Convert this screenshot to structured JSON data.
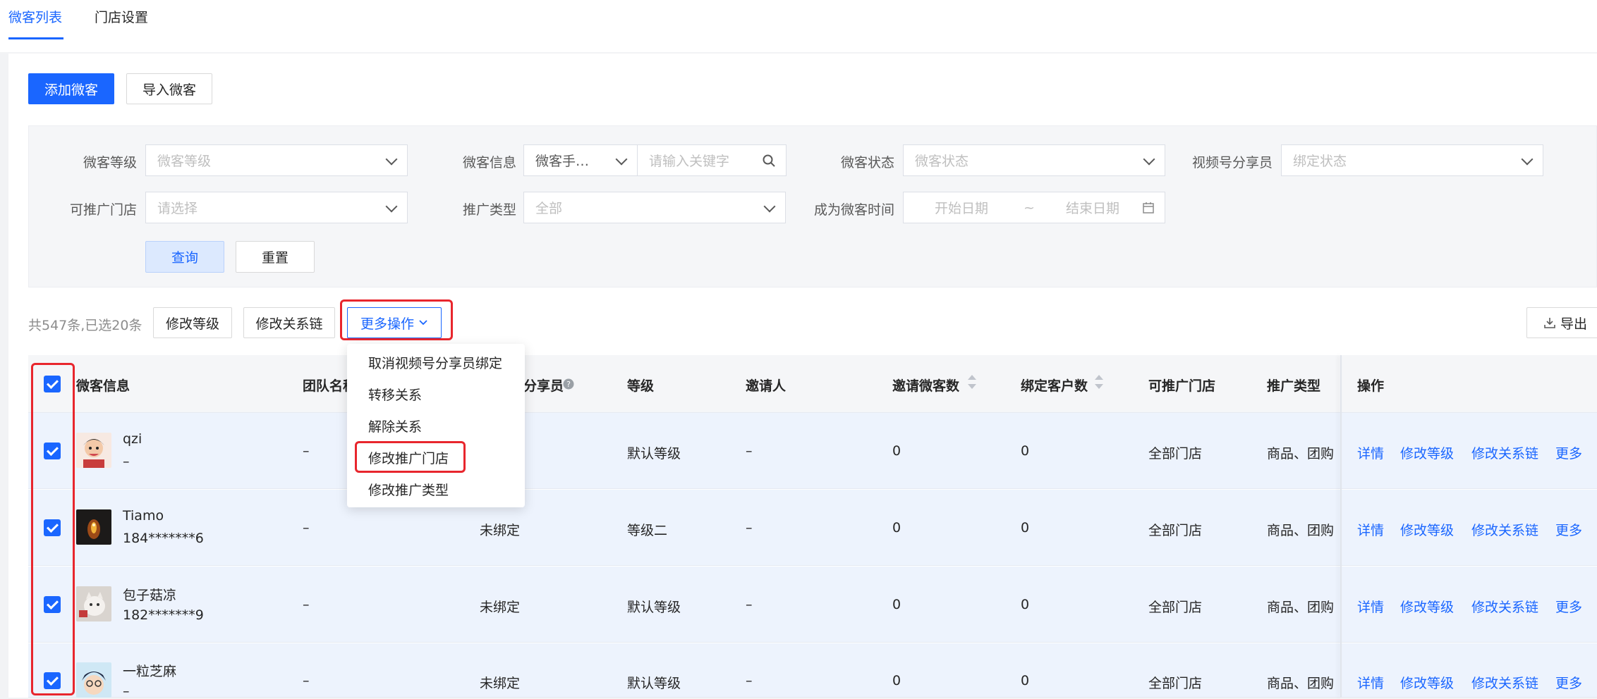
{
  "tabs": [
    {
      "label": "微客列表",
      "active": true
    },
    {
      "label": "门店设置",
      "active": false
    }
  ],
  "toolbar": {
    "add_label": "添加微客",
    "import_label": "导入微客"
  },
  "filters": {
    "level_label": "微客等级",
    "level_placeholder": "微客等级",
    "info_label": "微客信息",
    "info_type_value": "微客手…",
    "info_keyword_placeholder": "请输入关键字",
    "status_label": "微客状态",
    "status_placeholder": "微客状态",
    "sharer_label": "视频号分享员",
    "sharer_placeholder": "绑定状态",
    "store_label": "可推广门店",
    "store_placeholder": "请选择",
    "promo_type_label": "推广类型",
    "promo_type_value": "全部",
    "date_label": "成为微客时间",
    "start_placeholder": "开始日期",
    "date_sep": "~",
    "end_placeholder": "结束日期",
    "query_label": "查询",
    "reset_label": "重置"
  },
  "actions": {
    "count_text": "共547条,已选20条",
    "modify_level": "修改等级",
    "modify_chain": "修改关系链",
    "more_ops": "更多操作",
    "export": "导出"
  },
  "dropdown_menu": {
    "items": [
      "取消视频号分享员绑定",
      "转移关系",
      "解除关系",
      "修改推广门店",
      "修改推广类型"
    ],
    "highlighted": "修改推广门店"
  },
  "table": {
    "headers": {
      "info": "微客信息",
      "team_visible": "团队名称",
      "sharer_visible": "分享员",
      "level": "等级",
      "inviter": "邀请人",
      "invite_count": "邀请微客数",
      "bind_count": "绑定客户数",
      "stores": "可推广门店",
      "promo_type": "推广类型",
      "ops": "操作"
    },
    "rows": [
      {
        "name": "qzi",
        "phone": "–",
        "team": "–",
        "sharer": "",
        "level": "默认等级",
        "inviter": "–",
        "invite": "0",
        "bind": "0",
        "stores": "全部门店",
        "promo": "商品、团购"
      },
      {
        "name": "Tiamo",
        "phone": "184*******6",
        "team": "–",
        "sharer": "未绑定",
        "level": "等级二",
        "inviter": "–",
        "invite": "0",
        "bind": "0",
        "stores": "全部门店",
        "promo": "商品、团购"
      },
      {
        "name": "包子菇凉",
        "phone": "182*******9",
        "team": "–",
        "sharer": "未绑定",
        "level": "默认等级",
        "inviter": "–",
        "invite": "0",
        "bind": "0",
        "stores": "全部门店",
        "promo": "商品、团购"
      },
      {
        "name": "一粒芝麻",
        "phone": "–",
        "team": "–",
        "sharer": "未绑定",
        "level": "默认等级",
        "inviter": "–",
        "invite": "0",
        "bind": "0",
        "stores": "全部门店",
        "promo": "商品、团购"
      }
    ],
    "row_ops": {
      "detail": "详情",
      "modify_level": "修改等级",
      "modify_chain": "修改关系链",
      "more": "更多"
    }
  },
  "colors": {
    "accent": "#1a66ff",
    "highlight_box": "#e8262d",
    "selected_row": "#edf3fd"
  }
}
